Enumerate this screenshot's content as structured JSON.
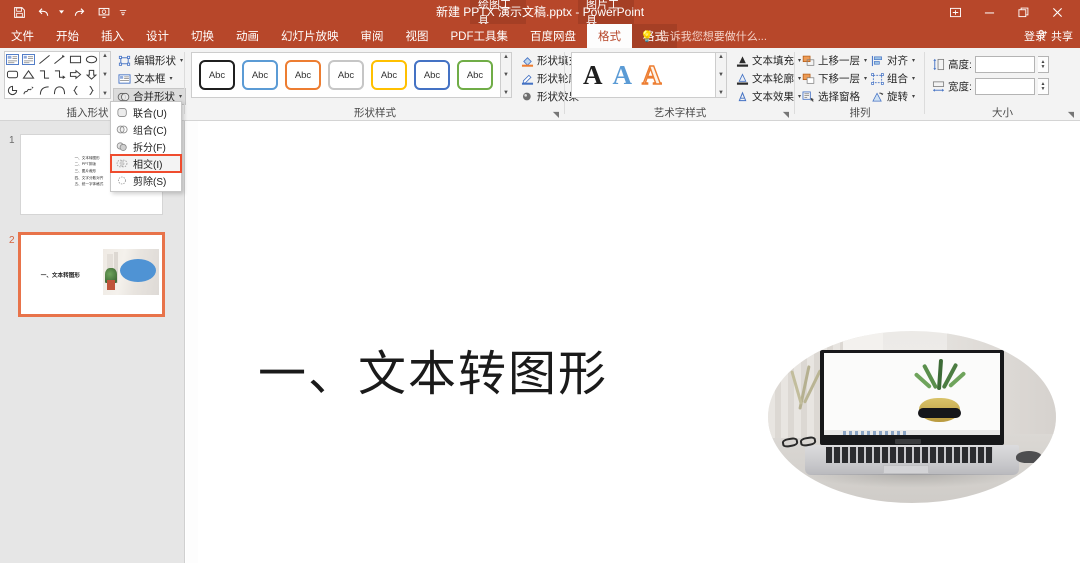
{
  "titlebar": {
    "document_title": "新建 PPTX 演示文稿.pptx - PowerPoint",
    "qat": [
      {
        "name": "save",
        "label": "保存"
      },
      {
        "name": "undo",
        "label": "撤销"
      },
      {
        "name": "redo",
        "label": "恢复"
      },
      {
        "name": "start-slideshow",
        "label": "从头开始"
      },
      {
        "name": "customize-qat",
        "label": "自定义快速访问工具栏"
      }
    ],
    "window_controls": [
      {
        "name": "ribbon-display-options",
        "glyph": "⊞"
      },
      {
        "name": "minimize",
        "glyph": "—"
      },
      {
        "name": "restore",
        "glyph": "❐"
      },
      {
        "name": "close",
        "glyph": "✕"
      }
    ],
    "context_tabs": [
      {
        "name": "drawing-tools",
        "label": "绘图工具"
      },
      {
        "name": "picture-tools",
        "label": "图片工具"
      }
    ]
  },
  "ribbon_tabs": [
    {
      "label": "文件",
      "active": false
    },
    {
      "label": "开始",
      "active": false
    },
    {
      "label": "插入",
      "active": false
    },
    {
      "label": "设计",
      "active": false
    },
    {
      "label": "切换",
      "active": false
    },
    {
      "label": "动画",
      "active": false
    },
    {
      "label": "幻灯片放映",
      "active": false
    },
    {
      "label": "审阅",
      "active": false
    },
    {
      "label": "视图",
      "active": false
    },
    {
      "label": "PDF工具集",
      "active": false
    },
    {
      "label": "百度网盘",
      "active": false
    },
    {
      "label": "格式",
      "active": true
    },
    {
      "label": "格式",
      "active": false
    }
  ],
  "tell_me": "告诉我您想要做什么...",
  "signin_label": "登录",
  "share_label": "共享",
  "ribbon": {
    "groups": [
      {
        "name": "insert-shapes",
        "title": "插入形状"
      },
      {
        "name": "shape-styles",
        "title": "形状样式"
      },
      {
        "name": "wordart-styles",
        "title": "艺术字样式"
      },
      {
        "name": "arrange",
        "title": "排列"
      },
      {
        "name": "size",
        "title": "大小"
      }
    ],
    "insert_shapes": {
      "edit_shape": "编辑形状",
      "text_box": "文本框",
      "merge_shapes": "合并形状"
    },
    "shape_styles": {
      "sample_text": "Abc",
      "shape_fill": "形状填充",
      "shape_outline": "形状轮廓",
      "shape_effects": "形状效果",
      "swatch_colors": [
        "#1f1f1f",
        "#5b9bd5",
        "#ed7d31",
        "#a5a5a5",
        "#ffc000",
        "#4472c4",
        "#70ad47"
      ]
    },
    "wordart_styles": {
      "sample_letter": "A",
      "text_fill": "文本填充",
      "text_outline": "文本轮廓",
      "text_effects": "文本效果",
      "letter_colors": [
        "#1f1f1f",
        "#5b9bd5",
        "#ed7d31"
      ]
    },
    "arrange": {
      "bring_forward": "上移一层",
      "send_backward": "下移一层",
      "selection_pane": "选择窗格",
      "align": "对齐",
      "group": "组合",
      "rotate": "旋转"
    },
    "size": {
      "height_label": "高度:",
      "height_value": "",
      "width_label": "宽度:",
      "width_value": ""
    }
  },
  "merge_menu": {
    "items": [
      {
        "label": "联合(U)",
        "icon": "union-icon",
        "highlighted": false
      },
      {
        "label": "组合(C)",
        "icon": "combine-icon",
        "highlighted": false
      },
      {
        "label": "拆分(F)",
        "icon": "fragment-icon",
        "highlighted": false
      },
      {
        "label": "相交(I)",
        "icon": "intersect-icon",
        "highlighted": true
      },
      {
        "label": "剪除(S)",
        "icon": "subtract-icon",
        "highlighted": false
      }
    ],
    "highlight_color": "#ef4c2e"
  },
  "slide_panel": {
    "slides": [
      {
        "number": "1",
        "selected": false,
        "lines": [
          "一、文本转图形",
          "二、PPT排版",
          "三、图片裁形",
          "四、文字分散对齐",
          "五、统一字体格式"
        ]
      },
      {
        "number": "2",
        "selected": true,
        "title": "一、文本转图形"
      }
    ]
  },
  "slide": {
    "title": "一、文本转图形",
    "picture_alt": "笔记本电脑与菠萝图片（椭圆裁剪）"
  },
  "colors": {
    "ribbon_accent": "#b7472a",
    "context_tab": "#a53f25",
    "selection_orange": "#e8734a",
    "highlight_red": "#ef4c2e",
    "ribbon_bg": "#f3f3f3",
    "panel_bg": "#e6e6e6"
  }
}
